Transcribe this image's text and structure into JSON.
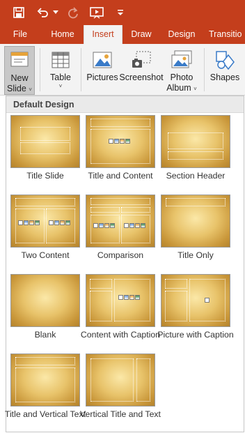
{
  "qat": {
    "icons": [
      "save-icon",
      "undo-icon",
      "undo-dropdown-icon",
      "redo-icon",
      "start-from-beginning-icon",
      "customize-qat-icon"
    ]
  },
  "tabs": [
    {
      "label": "File",
      "active": false
    },
    {
      "label": "Home",
      "active": false
    },
    {
      "label": "Insert",
      "active": true
    },
    {
      "label": "Draw",
      "active": false
    },
    {
      "label": "Design",
      "active": false
    },
    {
      "label": "Transitio",
      "active": false
    }
  ],
  "ribbon": {
    "new_slide": {
      "line1": "New",
      "line2": "Slide",
      "chevron": "˅"
    },
    "table": {
      "label": "Table",
      "chevron": "˅"
    },
    "pictures": {
      "label": "Pictures"
    },
    "screenshot": {
      "label": "Screenshot"
    },
    "photo_album": {
      "line1": "Photo",
      "line2": "Album",
      "chevron": "˅"
    },
    "shapes": {
      "label": "Shapes"
    }
  },
  "gallery": {
    "header": "Default Design",
    "layouts": [
      {
        "name": "Title Slide"
      },
      {
        "name": "Title and Content"
      },
      {
        "name": "Section Header"
      },
      {
        "name": "Two Content"
      },
      {
        "name": "Comparison"
      },
      {
        "name": "Title Only"
      },
      {
        "name": "Blank"
      },
      {
        "name": "Content with Caption"
      },
      {
        "name": "Picture with Caption"
      },
      {
        "name": "Title and Vertical Text"
      },
      {
        "name": "Vertical Title and Text"
      }
    ]
  },
  "colors": {
    "accent": "#c43e1c",
    "ribbon_bg": "#f3f3f3",
    "thumb_gold": "#e8c36a"
  }
}
